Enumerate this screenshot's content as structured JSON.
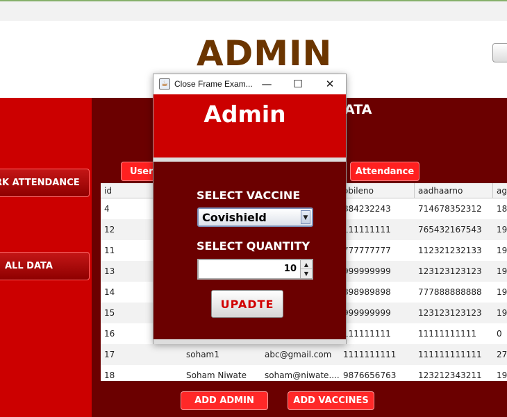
{
  "header": {
    "title": "ADMIN"
  },
  "sidebar": {
    "mark_attendance_label": "RK ATTENDANCE",
    "all_data_label": "ALL DATA"
  },
  "main": {
    "section_heading_fragment": "ATA",
    "tabs": [
      {
        "label": "UserD"
      },
      {
        "label": "Attendance"
      }
    ]
  },
  "table": {
    "columns": [
      "id",
      "",
      "",
      "obileno",
      "aadhaarno",
      "ag"
    ],
    "rows": [
      [
        "4",
        "",
        "",
        "884232243",
        "714678352312",
        "18"
      ],
      [
        "12",
        "",
        "",
        "111111111",
        "765432167543",
        "19"
      ],
      [
        "11",
        "",
        "",
        "777777777",
        "112321232133",
        "19"
      ],
      [
        "13",
        "",
        "",
        "999999999",
        "123123123123",
        "19"
      ],
      [
        "14",
        "",
        "",
        "898989898",
        "777888888888",
        "19"
      ],
      [
        "15",
        "",
        "",
        "999999999",
        "123123123123",
        "19"
      ],
      [
        "16",
        "",
        "",
        "111111111",
        "11111111111",
        "0"
      ],
      [
        "17",
        "soham1",
        "abc@gmail.com",
        "1111111111",
        "111111111111",
        "27"
      ],
      [
        "18",
        "Soham Niwate",
        "soham@niwate....",
        "9876656763",
        "123212343211",
        "19"
      ]
    ]
  },
  "footer": {
    "add_admin_label": "ADD ADMIN",
    "add_vaccines_label": "ADD VACCINES"
  },
  "dialog": {
    "window_title": "Close Frame Exam...",
    "heading": "Admin",
    "vaccine_label": "SELECT VACCINE",
    "vaccine_selected": "Covishield",
    "quantity_label": "SELECT QUANTITY",
    "quantity_value": "10",
    "update_label": "UPADTE"
  },
  "colors": {
    "accent_red": "#cc0000",
    "dark_maroon": "#6b0000",
    "title_brown": "#6b3500",
    "button_red": "#ff2828"
  }
}
